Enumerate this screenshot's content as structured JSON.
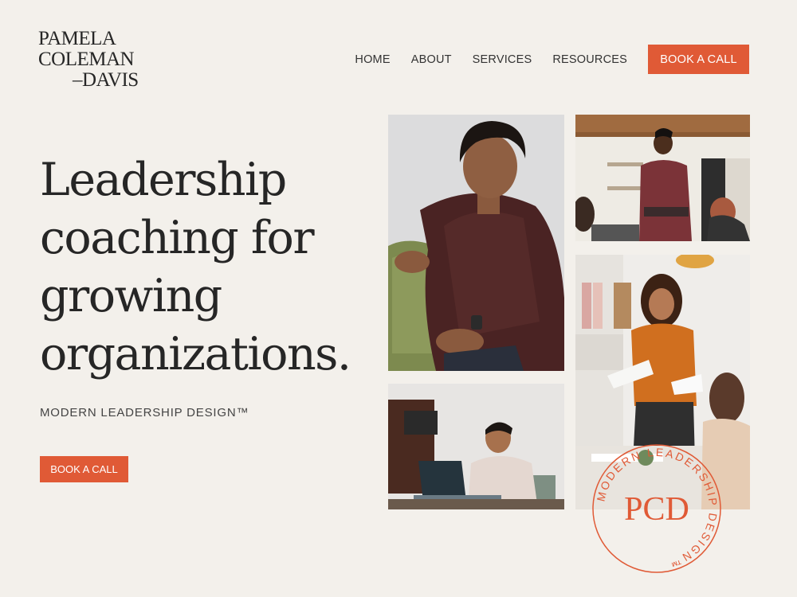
{
  "brand": {
    "logo_lines": [
      "PAMELA",
      "COLEMAN",
      "–DAVIS"
    ],
    "accent_color": "#e05a36"
  },
  "nav": {
    "items": [
      "HOME",
      "ABOUT",
      "SERVICES",
      "RESOURCES"
    ],
    "cta": "BOOK A CALL"
  },
  "hero": {
    "title_lines": [
      "Leadership",
      "coaching for",
      "growing",
      "organizations."
    ],
    "tagline": "MODERN LEADERSHIP DESIGN™",
    "cta": "BOOK A CALL"
  },
  "stamp": {
    "ring_text": "MODERN LEADERSHIP DESIGN™",
    "monogram": "PCD"
  }
}
